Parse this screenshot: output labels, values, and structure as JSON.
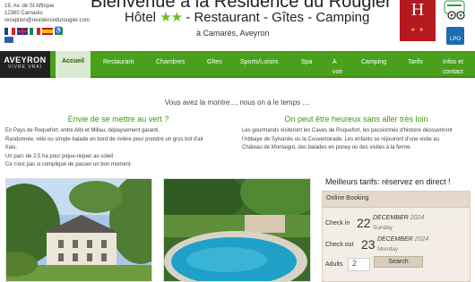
{
  "header": {
    "address_lines": [
      "19, Av. de St Affrique",
      "12360 Camarès",
      "reception@residencedurougier.com"
    ],
    "title": "Bienvenue à la Résidence du Rougier",
    "subtitle_prefix": "Hôtel",
    "stars": "★★",
    "subtitle_suffix": "- Restaurant - Gîtes - Camping",
    "location": "à Camarès, Aveyron",
    "logo_letter": "H",
    "logo_stars": "★ ★",
    "lpo_text": "LPO"
  },
  "languages": [
    "fr-flag-icon",
    "en-flag-icon",
    "it-flag-icon",
    "es-flag-icon",
    "accessibility-icon"
  ],
  "nav": {
    "brand_line1": "AVEYRON",
    "brand_line2": "VIVRE VRAI",
    "items": [
      "Accueil",
      "Restaurant",
      "Chambres",
      "Gîtes",
      "Sports/Loisirs",
      "Spa",
      "A",
      "voir",
      "Camping",
      "Tarifs",
      "Infos et",
      "contact"
    ]
  },
  "main": {
    "lead": "Vous avez la montre..., nous on a le temps ....",
    "left_heading": "Envie de se mettre au vert ?",
    "left_lines": [
      "En Pays de Roquefort, entre Albi et Millau, dépaysement garanti.",
      "Randonnée, vélo ou simple balade en bord de rivière pour prendre un gros bol d'air",
      "frais.",
      "Un parc de 2,5 ha pour pique-niquer au soleil",
      "Ce n'est pas si compliqué de passer un bon moment."
    ],
    "right_heading": "On peut être heureux sans aller très loin",
    "right_lines": [
      "Les gourmands visiteront les Caves de Roquefort, les passionnés d'histoire découvriront",
      "l'Abbaye de Sylvanès ou la Couvertoirade. Les enfants se réjouiront d'une visite au",
      "Château de Montaigut, des balades en poney ou des visites à la ferme."
    ]
  },
  "booking": {
    "tagline": "Meilleurs tarifs: réservez en direct !",
    "header": "Online Booking",
    "checkin_label": "Check in",
    "checkin_day": "22",
    "checkin_month": "DECEMBER",
    "checkin_year": "2024",
    "checkin_weekday": "Sunday",
    "checkout_label": "Check out",
    "checkout_day": "23",
    "checkout_month": "DECEMBER",
    "checkout_year": "2024",
    "checkout_weekday": "Monday",
    "adults_label": "Adults",
    "adults_value": "2",
    "search_label": "Search"
  },
  "colors": {
    "nav_green": "#4aa01c",
    "heading_green": "#3c9a10",
    "logo_red": "#b5191f",
    "booking_bg": "#f3ede5"
  }
}
